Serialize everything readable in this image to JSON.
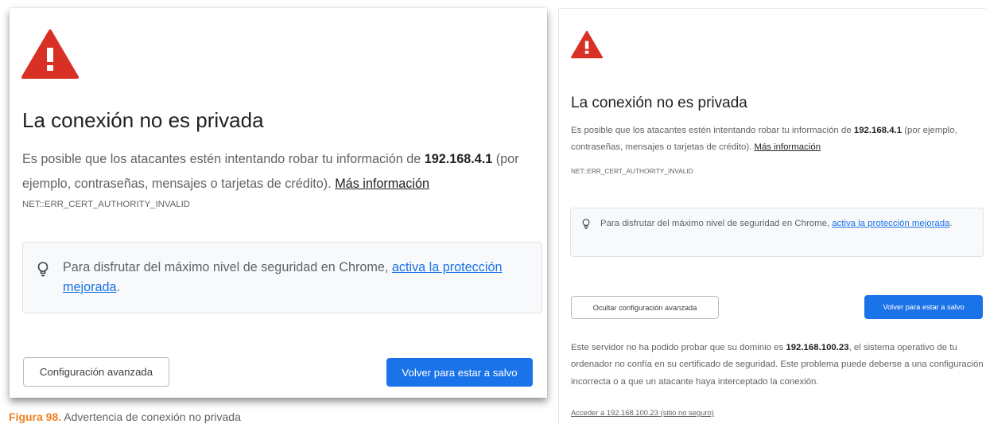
{
  "colors": {
    "warning_red": "#d93025",
    "primary_blue": "#1a73e8",
    "text_dark": "#202124",
    "text_gray": "#5f6368",
    "tip_bg": "#f8f9fa",
    "caption_orange": "#f0821f"
  },
  "left_panel": {
    "warning_icon": "warning-triangle-icon",
    "title": "La conexión no es privada",
    "desc_pre": "Es posible que los atacantes estén intentando robar tu información de ",
    "host": "192.168.4.1",
    "desc_post": " (por ejemplo, contraseñas, mensajes o tarjetas de crédito). ",
    "more_link": "Más información",
    "error_code": "NET::ERR_CERT_AUTHORITY_INVALID",
    "tip_icon": "lightbulb-icon",
    "tip_pre": "Para disfrutar del máximo nivel de seguridad en Chrome, ",
    "tip_link": "activa la protección mejorada",
    "tip_post": ".",
    "advanced_button": "Configuración avanzada",
    "back_button": "Volver para estar a salvo"
  },
  "right_panel": {
    "warning_icon": "warning-triangle-icon",
    "title": "La conexión no es privada",
    "desc_pre": "Es posible que los atacantes estén intentando robar tu información de ",
    "host": "192.168.4.1",
    "desc_post": " (por ejemplo, contraseñas, mensajes o tarjetas de crédito). ",
    "more_link": "Más información",
    "error_code": "NET::ERR_CERT_AUTHORITY_INVALID",
    "tip_icon": "lightbulb-icon",
    "tip_pre": "Para disfrutar del máximo nivel de seguridad en Chrome, ",
    "tip_link": "activa la protección mejorada",
    "tip_post": ".",
    "hide_advanced_button": "Ocultar configuración avanzada",
    "back_button": "Volver para estar a salvo",
    "advanced_pre": "Este servidor no ha podido probar que su dominio es ",
    "advanced_domain": "192.168.100.23",
    "advanced_post": ", el sistema operativo de tu ordenador no confía en su certificado de seguridad. Este problema puede deberse a una configuración incorrecta o a que un atacante haya interceptado la conexión.",
    "proceed_link": "Acceder a 192.168.100.23 (sitio no seguro)"
  },
  "caption": {
    "figure_label": "Figura 98.",
    "text": " Advertencia de conexión no privada"
  }
}
